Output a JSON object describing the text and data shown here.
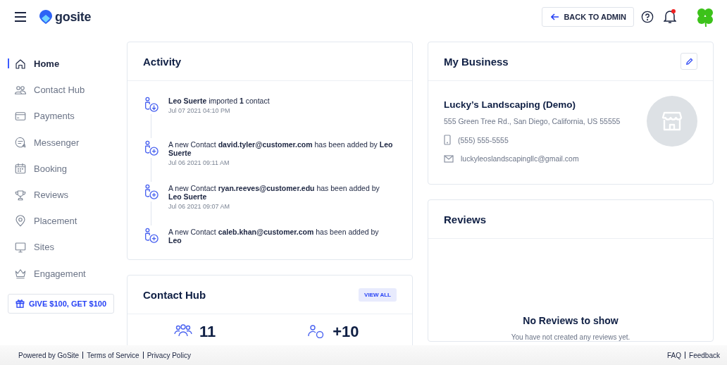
{
  "header": {
    "brand": "gosite",
    "back_button": "BACK TO ADMIN",
    "notifications": {
      "unread": true
    }
  },
  "sidebar": {
    "items": [
      {
        "label": "Home",
        "selected": true
      },
      {
        "label": "Contact Hub",
        "selected": false
      },
      {
        "label": "Payments",
        "selected": false
      },
      {
        "label": "Messenger",
        "selected": false
      },
      {
        "label": "Booking",
        "selected": false
      },
      {
        "label": "Reviews",
        "selected": false
      },
      {
        "label": "Placement",
        "selected": false
      },
      {
        "label": "Sites",
        "selected": false
      },
      {
        "label": "Engagement",
        "selected": false
      }
    ],
    "referral_button": "GIVE $100, GET $100"
  },
  "activity": {
    "title": "Activity",
    "items": [
      {
        "kind": "import",
        "text": "**Leo Suerte** imported **1** contact",
        "time": "Jul 07 2021 04:10 PM"
      },
      {
        "kind": "add",
        "text": "A new Contact **david.tyler@customer.com** has been added by **Leo Suerte**",
        "time": "Jul 06 2021 09:11 AM"
      },
      {
        "kind": "add",
        "text": "A new Contact **ryan.reeves@customer.edu** has been added by **Leo Suerte**",
        "time": "Jul 06 2021 09:07 AM"
      },
      {
        "kind": "add",
        "text": "A new Contact **caleb.khan@customer.com** has been added by **Leo**"
      }
    ]
  },
  "contact_hub": {
    "title": "Contact Hub",
    "view_all": "VIEW ALL",
    "stats": [
      {
        "kind": "total",
        "value": "11"
      },
      {
        "kind": "new",
        "value": "+10"
      }
    ]
  },
  "my_business": {
    "title": "My Business",
    "name": "Lucky’s Landscaping (Demo)",
    "address": "555 Green Tree Rd.,  San Diego, California, US 55555",
    "phone": "(555) 555-5555",
    "email": "luckyleoslandscapingllc@gmail.com"
  },
  "reviews": {
    "title": "Reviews",
    "empty_title": "No Reviews to show",
    "empty_text": "You have not created any reviews yet."
  },
  "footer": {
    "left_links": [
      "Powered by GoSite",
      "Terms of Service",
      "Privacy Policy"
    ],
    "right_links": [
      "FAQ",
      "Feedback"
    ]
  }
}
